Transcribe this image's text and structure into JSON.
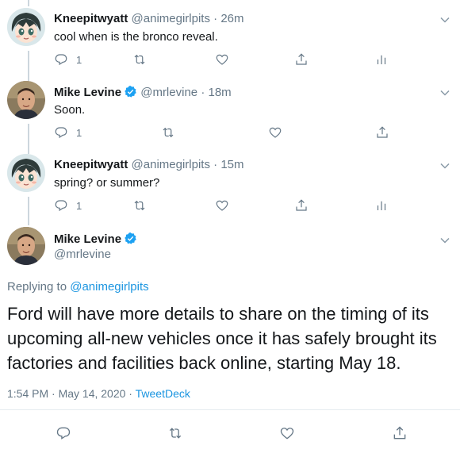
{
  "tweets": [
    {
      "name": "Kneepitwyatt",
      "handle": "@animegirlpits",
      "time": "26m",
      "text": "cool when is the bronco reveal.",
      "replies": "1",
      "verified": false
    },
    {
      "name": "Mike Levine",
      "handle": "@mrlevine",
      "time": "18m",
      "text": "Soon.",
      "replies": "1",
      "verified": true
    },
    {
      "name": "Kneepitwyatt",
      "handle": "@animegirlpits",
      "time": "15m",
      "text": "spring? or summer?",
      "replies": "1",
      "verified": false
    }
  ],
  "main": {
    "name": "Mike Levine",
    "handle": "@mrlevine",
    "replying_prefix": "Replying to",
    "replying_to": "@animegirlpits",
    "line1": "Ford will have more details to share on the timing of its",
    "line2": "upcoming all-new vehicles once it has safely brought its",
    "line3": "factories and facilities back online, starting May 18.",
    "timestamp": "1:54 PM · May 14, 2020 · ",
    "source": "TweetDeck"
  },
  "colors": {
    "accent": "#1b95e0",
    "verified": "#1da1f2",
    "muted": "#657786"
  }
}
